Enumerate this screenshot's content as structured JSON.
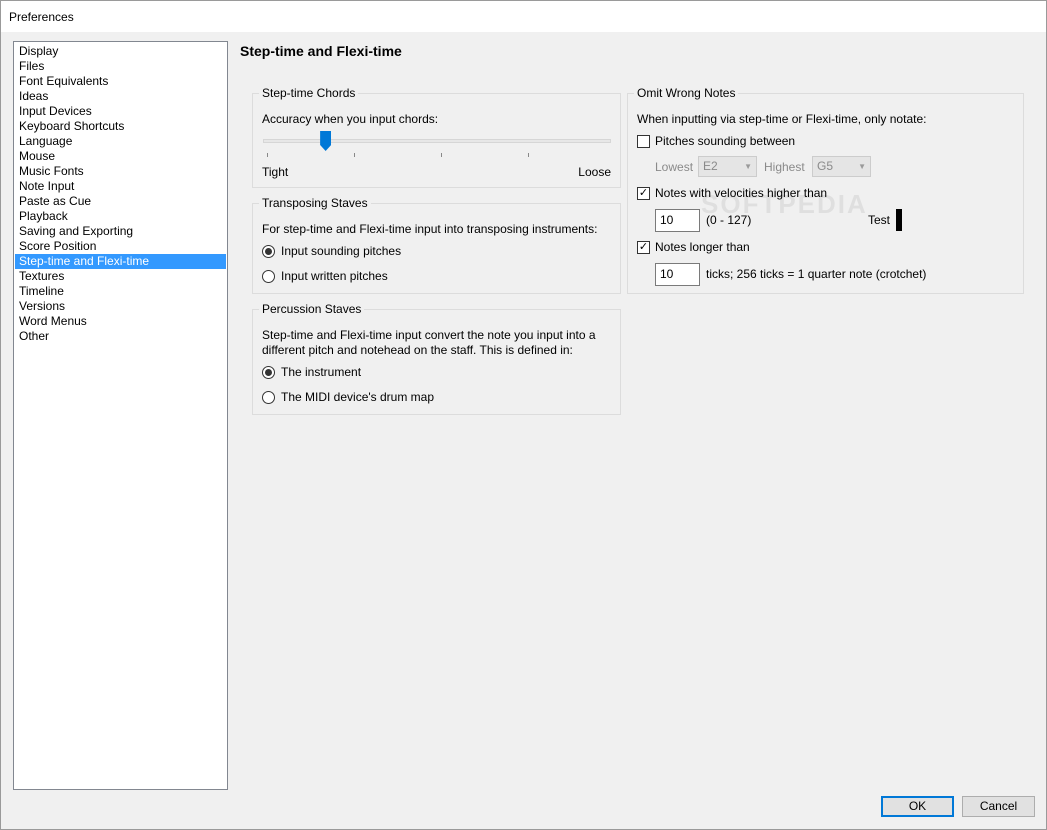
{
  "window": {
    "title": "Preferences"
  },
  "categories": [
    {
      "label": "Display"
    },
    {
      "label": "Files"
    },
    {
      "label": "Font Equivalents"
    },
    {
      "label": "Ideas"
    },
    {
      "label": "Input Devices"
    },
    {
      "label": "Keyboard Shortcuts"
    },
    {
      "label": "Language"
    },
    {
      "label": "Mouse"
    },
    {
      "label": "Music Fonts"
    },
    {
      "label": "Note Input"
    },
    {
      "label": "Paste as Cue"
    },
    {
      "label": "Playback"
    },
    {
      "label": "Saving and Exporting"
    },
    {
      "label": "Score Position"
    },
    {
      "label": "Step-time and Flexi-time",
      "selected": true
    },
    {
      "label": "Textures"
    },
    {
      "label": "Timeline"
    },
    {
      "label": "Versions"
    },
    {
      "label": "Word Menus"
    },
    {
      "label": "Other"
    }
  ],
  "page": {
    "title": "Step-time and Flexi-time"
  },
  "chords": {
    "group_label": "Step-time Chords",
    "accuracy_label": "Accuracy when you input chords:",
    "tight_label": "Tight",
    "loose_label": "Loose",
    "slider_fraction": 0.18
  },
  "transposing": {
    "group_label": "Transposing Staves",
    "description": "For step-time and Flexi-time input into transposing instruments:",
    "option_sounding": "Input sounding pitches",
    "option_written": "Input written pitches",
    "selected": "sounding"
  },
  "percussion": {
    "group_label": "Percussion Staves",
    "description_line1": "Step-time and Flexi-time input convert the note you input into a",
    "description_line2": "different pitch and notehead on the staff. This is defined in:",
    "option_instrument": "The instrument",
    "option_drum_map": "The MIDI device's drum map",
    "selected": "instrument"
  },
  "omit": {
    "group_label": "Omit Wrong Notes",
    "description": "When inputting via step-time or Flexi-time, only notate:",
    "pitches_label": "Pitches sounding between",
    "pitches_checked": false,
    "lowest_label": "Lowest",
    "lowest_value": "E2",
    "highest_label": "Highest",
    "highest_value": "G5",
    "velocities_label": "Notes with velocities higher than",
    "velocities_checked": true,
    "velocity_value": "10",
    "velocity_range": "(0 - 127)",
    "test_label": "Test",
    "longer_label": "Notes longer than",
    "longer_checked": true,
    "ticks_value": "10",
    "ticks_hint": "ticks; 256 ticks = 1 quarter note (crotchet)"
  },
  "watermark": "SOFTPEDIA",
  "buttons": {
    "ok": "OK",
    "cancel": "Cancel"
  }
}
